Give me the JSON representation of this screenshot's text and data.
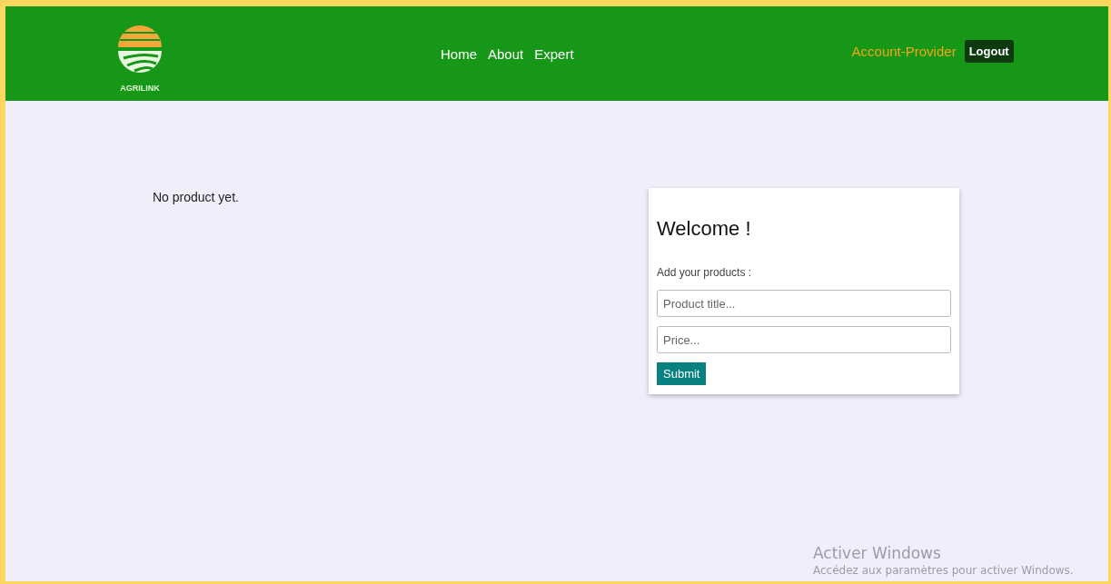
{
  "header": {
    "logo_text": "AGRILINK",
    "nav": [
      {
        "label": "Home"
      },
      {
        "label": "About"
      },
      {
        "label": "Expert"
      }
    ],
    "account": "Account-Provider",
    "logout": "Logout"
  },
  "products": {
    "empty_message": "No product yet."
  },
  "card": {
    "title": "Welcome !",
    "subtitle": "Add your products :",
    "fields": [
      {
        "placeholder": "Product title..."
      },
      {
        "placeholder": "Price..."
      }
    ],
    "submit": "Submit"
  },
  "os_overlay": {
    "title": "Activer Windows",
    "message": "Accédez aux paramètres pour activer Windows."
  }
}
